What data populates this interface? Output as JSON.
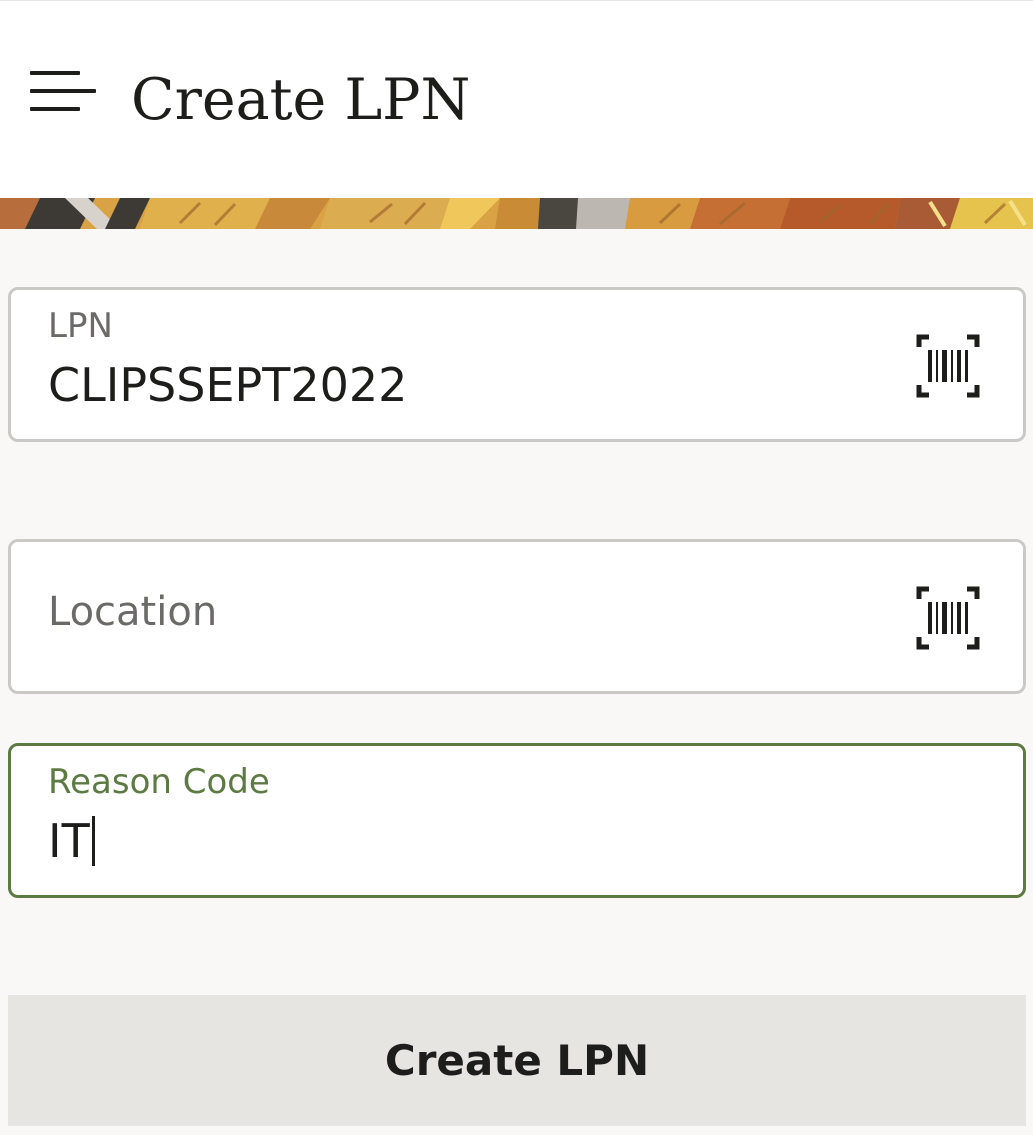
{
  "header": {
    "title": "Create LPN",
    "menu_icon": "hamburger-menu-icon"
  },
  "colors": {
    "page_background": "#f9f8f6",
    "text": "#1d1d1b",
    "field_border": "#cbc9c5",
    "focused_accent": "#5d7a43",
    "button_background": "#e6e5e2"
  },
  "form": {
    "lpn": {
      "label": "LPN",
      "value": "CLIPSSEPT2022",
      "scan_icon": "barcode-scan-icon"
    },
    "location": {
      "label": "Location",
      "value": "",
      "scan_icon": "barcode-scan-icon"
    },
    "reason_code": {
      "label": "Reason Code",
      "value": "IT",
      "focused": true
    }
  },
  "actions": {
    "create_label": "Create LPN"
  }
}
